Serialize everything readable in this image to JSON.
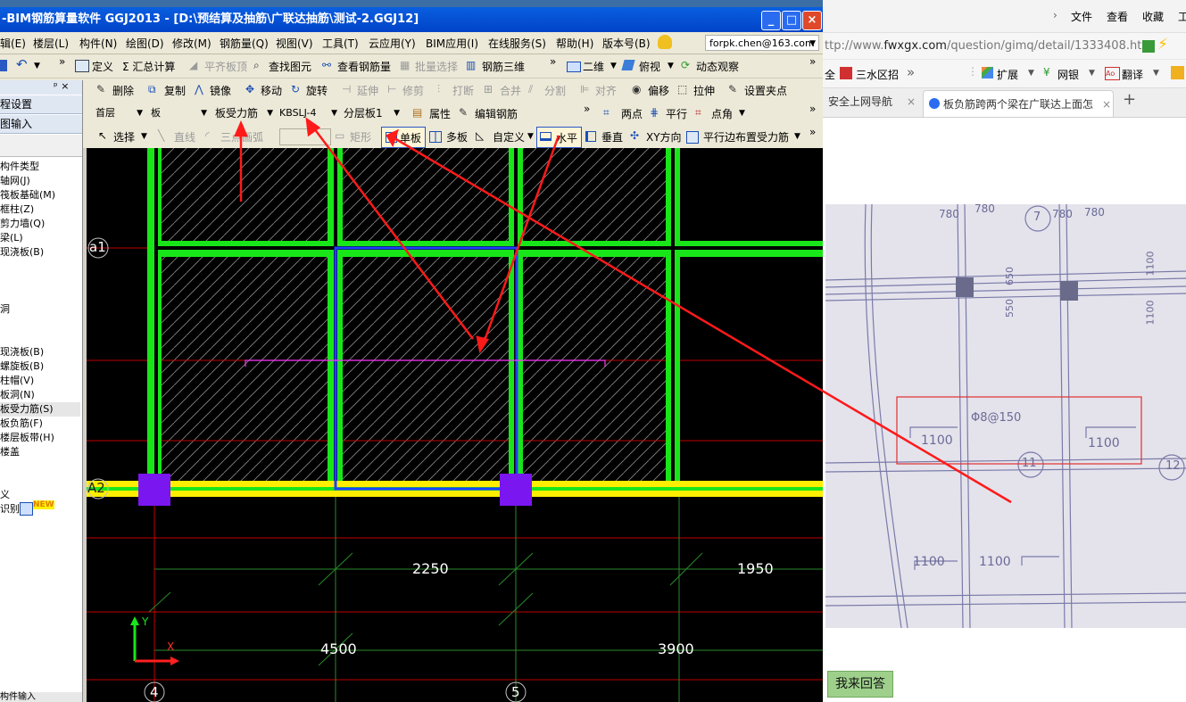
{
  "app": {
    "title": "-BIM钢筋算量软件 GGJ2013 - [D:\\预结算及抽筋\\广联达抽筋\\测试-2.GGJ12]",
    "win_buttons": [
      "_",
      "□",
      "×"
    ],
    "menu": [
      "辑(E)",
      "楼层(L)",
      "构件(N)",
      "绘图(D)",
      "修改(M)",
      "钢筋量(Q)",
      "视图(V)",
      "工具(T)",
      "云应用(Y)",
      "BIM应用(I)",
      "在线服务(S)",
      "帮助(H)",
      "版本号(B)"
    ],
    "account": "forpk.chen@163.com",
    "toolbar1": {
      "define": "定义",
      "summary": "Σ 汇总计算",
      "flat_top": "平齐板顶",
      "find": "查找图元",
      "view_rebar": "查看钢筋量",
      "batch_select": "批量选择",
      "rebar3d": "钢筋三维",
      "view2d": "二维",
      "top_view": "俯视",
      "orbit": "动态观察"
    },
    "toolbar2": {
      "delete": "删除",
      "copy": "复制",
      "mirror": "镜像",
      "move": "移动",
      "rotate": "旋转",
      "extend": "延伸",
      "trim": "修剪",
      "break": "打断",
      "merge": "合并",
      "split": "分割",
      "align": "对齐",
      "offset": "偏移",
      "stretch": "拉伸",
      "set_grip": "设置夹点"
    },
    "toolbar3": {
      "floor": "首层",
      "category": "板",
      "component_type": "板受力筋",
      "component_name": "KBSLJ-4",
      "layer": "分层板1",
      "properties": "属性",
      "edit_rebar": "编辑钢筋",
      "two_points": "两点",
      "parallel": "平行",
      "point_angle": "点角"
    },
    "toolbar4": {
      "select": "选择",
      "line": "直线",
      "arc": "三点画弧",
      "rect": "矩形",
      "single_slab": "单板",
      "multi_slab": "多板",
      "custom": "自定义",
      "horizontal": "水平",
      "vertical": "垂直",
      "xy_dir": "XY方向",
      "parallel_edge": "平行边布置受力筋"
    },
    "left_panel": {
      "pin": "ᵖ ×",
      "project_settings": "程设置",
      "drawing_input": "图输入",
      "items": [
        "构件类型",
        "轴网(J)",
        "筏板基础(M)",
        "框柱(Z)",
        "剪力墙(Q)",
        "梁(L)",
        "现浇板(B)",
        "",
        "",
        "洞",
        "",
        "",
        "现浇板(B)",
        "螺旋板(B)",
        "柱帽(V)",
        "板洞(N)",
        "板受力筋(S)",
        "板负筋(F)",
        "楼层板带(H)",
        "楼盖",
        "",
        "",
        "义",
        "识别"
      ],
      "new_badge": "NEW",
      "bottom": "构件输入"
    },
    "canvas": {
      "axis_labels": [
        "a1",
        "A2"
      ],
      "column_labels": [
        "4",
        "5"
      ],
      "dims_top": [
        "2250",
        "1950"
      ],
      "dims_bottom": [
        "4500",
        "3900"
      ],
      "ucs_x": "X",
      "ucs_y": "Y"
    }
  },
  "browser": {
    "menu": [
      "文件",
      "查看",
      "收藏",
      "工"
    ],
    "url_prefix": "ttp://www.",
    "url_domain": "fwxgx.com",
    "url_path": "/question/gimq/detail/1333408.htr",
    "bookmarks": {
      "sanshui": "三水区招",
      "more": "»",
      "extend": "扩展",
      "bank": "网银",
      "translate": "翻译"
    },
    "tabs": [
      "安全上网导航",
      "板负筋跨两个梁在广联达上面怎"
    ],
    "photo_text": {
      "dims_top": [
        "780",
        "780",
        "780",
        "780"
      ],
      "grid_nums": [
        "7",
        "11",
        "12"
      ],
      "rebar_note": "Φ8@150",
      "dims_mid": [
        "1100",
        "1100"
      ],
      "dims_low": [
        "1100",
        "1100"
      ],
      "side_dims": [
        "650",
        "550",
        "1100",
        "1100"
      ]
    },
    "answer_button": "我来回答"
  },
  "colors": {
    "title_blue": "#0a5fe0",
    "beam_green": "#19e619",
    "selected_blue": "#2040ff",
    "column_purple": "#7a16f0",
    "axis_yellow": "#ffee00",
    "annotation_red": "#ff1a1a",
    "answer_green": "#9ed08c"
  }
}
